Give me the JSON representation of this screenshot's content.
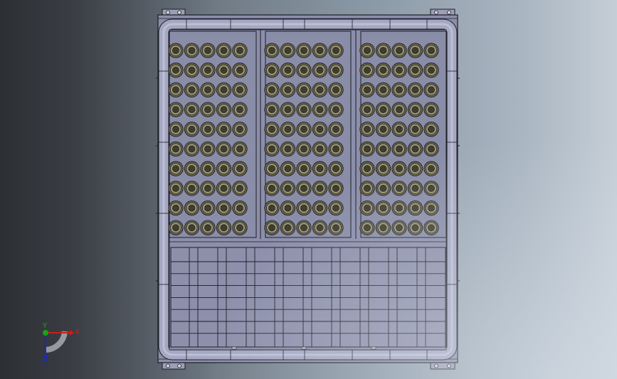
{
  "viewport": {
    "background_colors": [
      "#2c2f33",
      "#6f7a85",
      "#aab6c2",
      "#c5ced7"
    ]
  },
  "model": {
    "body_color": "#8c8fab",
    "edge_color": "#1b1d24",
    "tube_color": "#a5a8c2",
    "roller_outer": "#6b6650",
    "roller_ring": "#9a9670",
    "roller_inner": "#3f3c30",
    "panels": [
      {
        "name": "left",
        "cols": 5,
        "rows": 10
      },
      {
        "name": "middle",
        "cols": 5,
        "rows": 10
      },
      {
        "name": "right",
        "cols": 5,
        "rows": 10
      }
    ],
    "grid": {
      "rows": 8
    }
  },
  "triad": {
    "x_label": "X",
    "y_label": "Y",
    "z_label": "Z",
    "x_color": "#d11a1a",
    "y_color": "#1aa31a",
    "z_color": "#1a28c8"
  }
}
